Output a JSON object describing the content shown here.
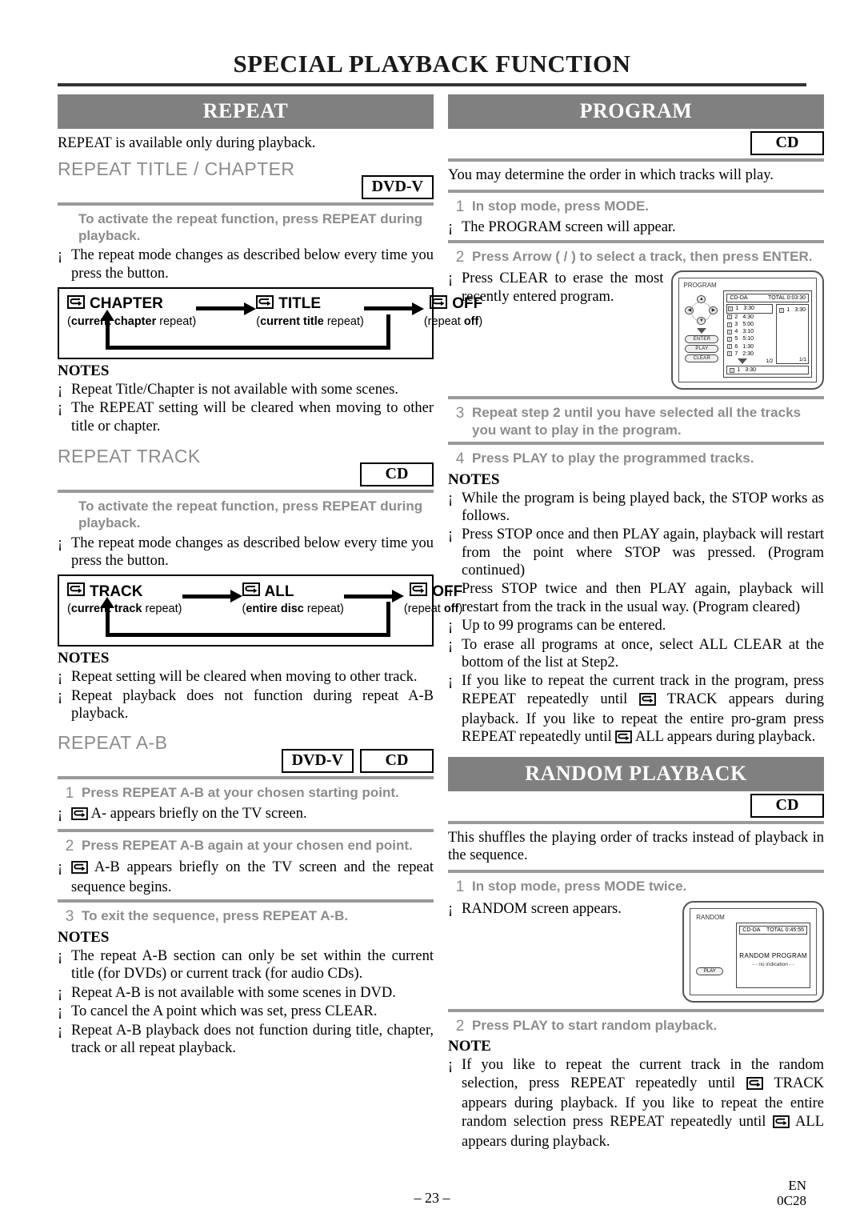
{
  "page": {
    "title": "SPECIAL PLAYBACK FUNCTION",
    "page_number": "– 23 –",
    "language_code": "EN",
    "doc_code": "0C28"
  },
  "badges": {
    "dvd_v": "DVD-V",
    "cd": "CD"
  },
  "repeat": {
    "banner": "REPEAT",
    "lead": "REPEAT is available only during playback.",
    "title_chapter": {
      "heading": "REPEAT TITLE / CHAPTER",
      "badge": "DVD-V",
      "instruction": "To activate the repeat function, press REPEAT during playback.",
      "bullet": "The repeat mode changes as described below every time you press the button.",
      "diagram": {
        "items": [
          {
            "label": "CHAPTER",
            "sub_bold": "current chapter",
            "sub_rest": " repeat",
            "paren_open": "(",
            "paren_close": ")"
          },
          {
            "label": "TITLE",
            "sub_bold": "current title",
            "sub_rest": " repeat",
            "paren_open": "(",
            "paren_close": ")"
          },
          {
            "label": "OFF",
            "sub_bold": "off",
            "sub_rest": "repeat ",
            "paren_open": "(",
            "paren_close": ")"
          }
        ]
      },
      "notes_heading": "NOTES",
      "notes": [
        "Repeat Title/Chapter is not available with some scenes.",
        "The REPEAT setting will be cleared when moving to other title or chapter."
      ]
    },
    "track": {
      "heading": "REPEAT TRACK",
      "badge": "CD",
      "instruction": "To activate the repeat function, press REPEAT during playback.",
      "bullet": "The repeat mode changes as described below every time you press the button.",
      "diagram": {
        "items": [
          {
            "label": "TRACK",
            "sub_bold": "current track",
            "sub_rest": " repeat"
          },
          {
            "label": "ALL",
            "sub_bold": "entire disc",
            "sub_rest": " repeat"
          },
          {
            "label": "OFF",
            "sub_bold": "off",
            "sub_rest": "repeat "
          }
        ]
      },
      "notes_heading": "NOTES",
      "notes": [
        "Repeat setting will be cleared when moving to other track.",
        "Repeat playback does not function during repeat A-B playback."
      ]
    },
    "ab": {
      "heading": "REPEAT A-B",
      "badge_dvd": "DVD-V",
      "badge_cd": "CD",
      "steps": [
        {
          "num": "1",
          "text": "Press REPEAT A-B at your chosen starting point."
        },
        {
          "num": "2",
          "text": "Press REPEAT A-B again at your chosen end point."
        },
        {
          "num": "3",
          "text": "To exit the sequence, press REPEAT A-B."
        }
      ],
      "bullet_1": "A- appears briefly on the TV screen.",
      "bullet_2": "A-B appears briefly on the TV screen and the repeat sequence begins.",
      "notes_heading": "NOTES",
      "notes": [
        "The repeat A-B section can only be set within the current title (for DVDs) or current track (for audio CDs).",
        "Repeat A-B is not available with some scenes in DVD.",
        "To cancel the A point which was set, press CLEAR.",
        "Repeat A-B playback does not function during title, chapter, track or all repeat playback."
      ]
    }
  },
  "program": {
    "banner": "PROGRAM",
    "badge": "CD",
    "lead": "You may determine the order in which tracks will play.",
    "steps": [
      {
        "num": "1",
        "text": "In stop mode, press MODE."
      },
      {
        "num": "2",
        "text": "Press Arrow (  /  ) to select a track, then press ENTER."
      },
      {
        "num": "3",
        "text": "Repeat step 2 until you have selected all the tracks you want to play in the program."
      },
      {
        "num": "4",
        "text": "Press PLAY to play the programmed tracks."
      }
    ],
    "bullet_after_1": "The PROGRAM screen will appear.",
    "bullet_after_2": "Press CLEAR to erase the most recently entered program.",
    "notes_heading": "NOTES",
    "notes": [
      "While the program is being played back, the STOP works as follows.",
      "Press STOP once and then PLAY again, playback will restart from the point where STOP was pressed. (Program continued)",
      "Press STOP twice and then PLAY again, playback will restart from the track in the usual way. (Program cleared)",
      "Up to 99 programs can be entered.",
      "To erase all programs at once, select ALL CLEAR at the bottom of the list at Step2."
    ],
    "note_repeat_part1": "If you like to repeat the current track in the program, press REPEAT repeatedly until",
    "note_repeat_part2": "TRACK appears during playback. If you like to repeat the entire pro-gram press REPEAT repeatedly until",
    "note_repeat_part3": "ALL appears during playback.",
    "osd": {
      "title": "PROGRAM",
      "disc_type": "CD-DA",
      "total": "TOTAL 0:03:30",
      "tracks": [
        {
          "no": "1",
          "time": "3:30"
        },
        {
          "no": "2",
          "time": "4:30"
        },
        {
          "no": "3",
          "time": "5:00"
        },
        {
          "no": "4",
          "time": "3:10"
        },
        {
          "no": "5",
          "time": "5:10"
        },
        {
          "no": "6",
          "time": "1:30"
        },
        {
          "no": "7",
          "time": "2:30"
        }
      ],
      "list_page": "1/2",
      "program_entries": [
        {
          "no": "1",
          "time": "3:30"
        }
      ],
      "program_page": "1/1",
      "bottom_entry": {
        "no": "1",
        "time": "3:30"
      },
      "buttons": [
        "ENTER",
        "PLAY",
        "CLEAR"
      ]
    }
  },
  "random": {
    "banner": "RANDOM PLAYBACK",
    "badge": "CD",
    "lead": "This shuffles the playing order of tracks instead of playback in the sequence.",
    "steps": [
      {
        "num": "1",
        "text": "In stop mode, press MODE twice."
      },
      {
        "num": "2",
        "text": "Press PLAY to start random playback."
      }
    ],
    "bullet_after_1": "RANDOM screen appears.",
    "note_heading": "NOTE",
    "note_part1": "If you like to repeat the current track in the random selection, press REPEAT repeatedly until",
    "note_part2": "TRACK appears during playback. If you like to repeat the entire random selection press REPEAT repeatedly until",
    "note_part3": "ALL appears during playback.",
    "osd": {
      "title": "RANDOM",
      "disc_type": "CD-DA",
      "total": "TOTAL 0:45:55",
      "center_line1": "RANDOM PROGRAM",
      "center_line2": "- - no indication - -",
      "button": "PLAY"
    }
  },
  "icons": {
    "repeat_loop": "repeat-loop-icon",
    "arrow_right": "arrow-right-icon",
    "triangle_down": "triangle-down-icon"
  },
  "colors": {
    "banner_bg": "#808080",
    "subhead_grey": "#8c8c8c",
    "rule_grey": "#9a9a9a"
  }
}
